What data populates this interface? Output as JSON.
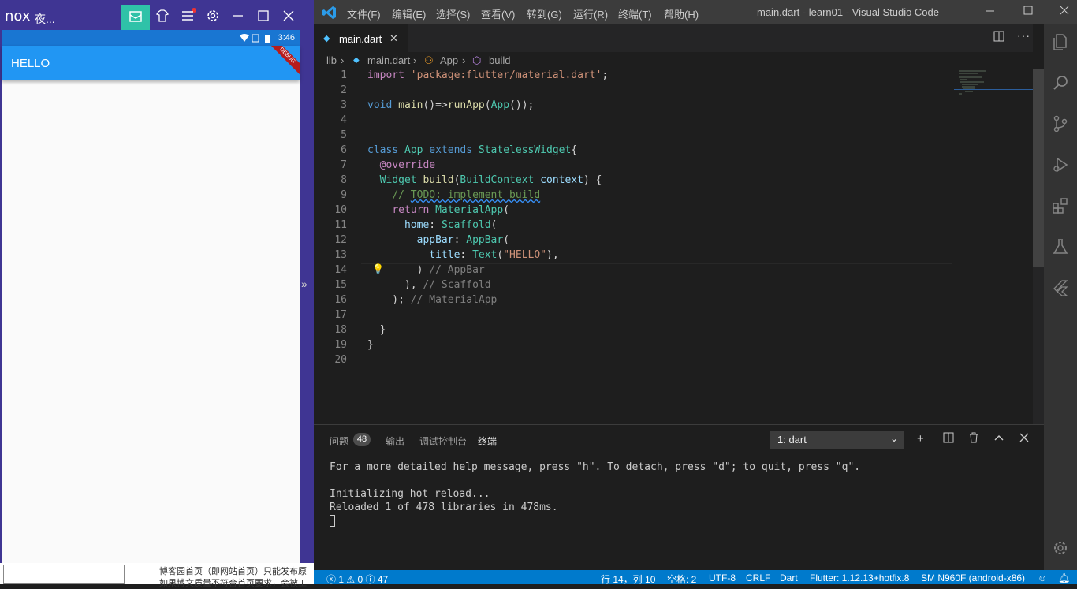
{
  "nox": {
    "logo": "nox",
    "title": "夜...",
    "status_time": "3:46",
    "app_title": "HELLO",
    "debug_banner": "DEBUG",
    "background_text_line1": "博客园首页（即网站首页）只能发布原",
    "background_text_line2": "如果博文质量不符合首页要求，会被工"
  },
  "vscode": {
    "menu": [
      "文件(F)",
      "编辑(E)",
      "选择(S)",
      "查看(V)",
      "转到(G)",
      "运行(R)",
      "终端(T)",
      "帮助(H)"
    ],
    "window_title": "main.dart - learn01 - Visual Studio Code",
    "tab_label": "main.dart",
    "breadcrumb": {
      "folder": "lib",
      "file": "main.dart",
      "class": "App",
      "method": "build"
    },
    "code_lines": [
      "import 'package:flutter/material.dart';",
      "",
      "void main()=>runApp(App());",
      "",
      "",
      "class App extends StatelessWidget{",
      "  @override",
      "  Widget build(BuildContext context) {",
      "    // TODO: implement build",
      "    return MaterialApp(",
      "      home: Scaffold(",
      "        appBar: AppBar(",
      "          title: Text(\"HELLO\"),",
      "        ) // AppBar",
      "      ), // Scaffold",
      "    ); // MaterialApp",
      "",
      "  }",
      "}",
      ""
    ],
    "panel": {
      "tabs": [
        "问题",
        "输出",
        "调试控制台",
        "终端"
      ],
      "problems_count": "48",
      "terminal_select": "1: dart",
      "terminal_lines": [
        "For a more detailed help message, press \"h\". To detach, press \"d\"; to quit, press \"q\".",
        "",
        "Initializing hot reload...",
        "Reloaded 1 of 478 libraries in 478ms."
      ]
    },
    "statusbar": {
      "errors": "1",
      "warnings": "0",
      "infos": "47",
      "position": "行 14，列 10",
      "spaces": "空格: 2",
      "encoding": "UTF-8",
      "eol": "CRLF",
      "language": "Dart",
      "flutter": "Flutter: 1.12.13+hotfix.8",
      "device": "SM N960F (android-x86)"
    }
  }
}
